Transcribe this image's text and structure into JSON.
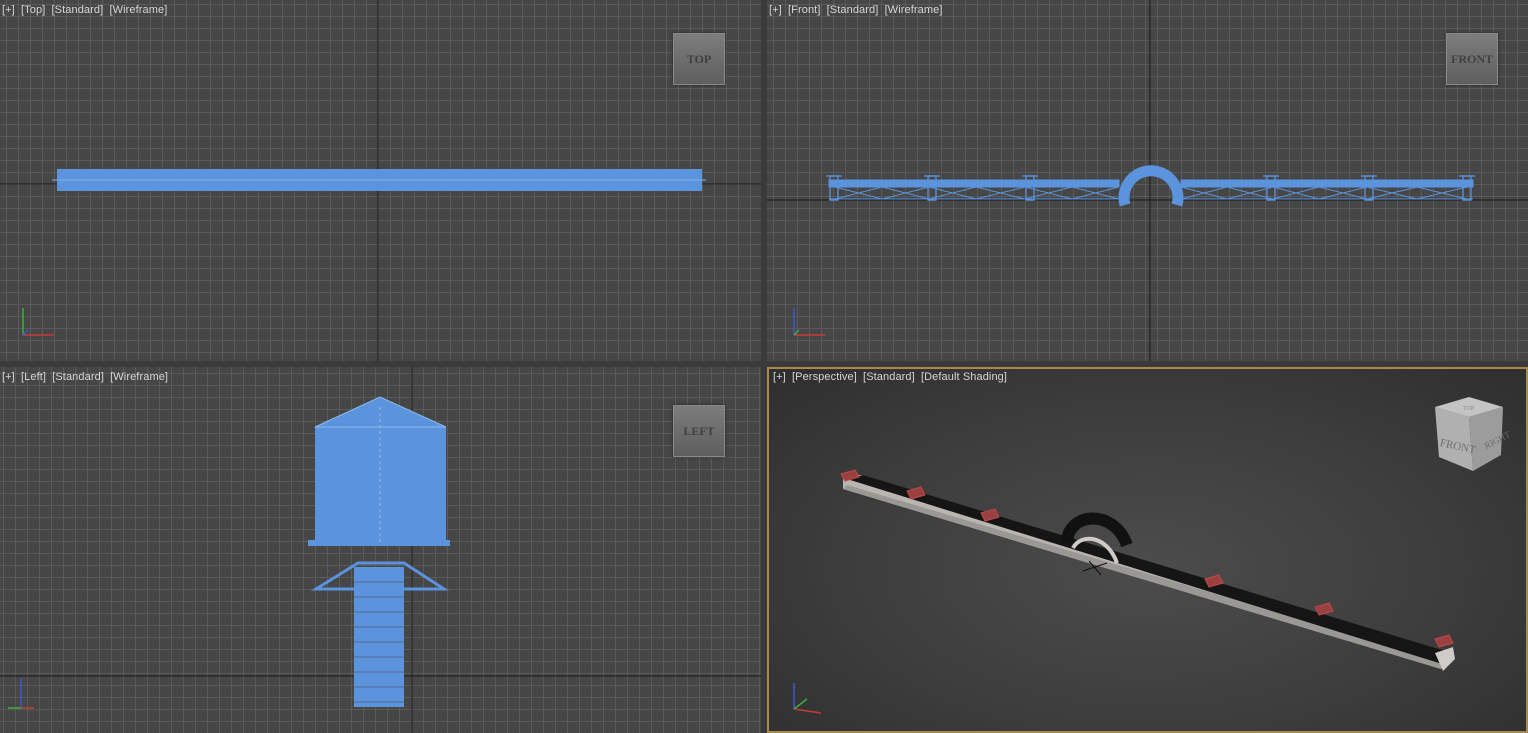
{
  "viewports": {
    "top": {
      "label": [
        "[+]",
        "[Top]",
        "[Standard]",
        "[Wireframe]"
      ],
      "cube": "TOP"
    },
    "front": {
      "label": [
        "[+]",
        "[Front]",
        "[Standard]",
        "[Wireframe]"
      ],
      "cube": "FRONT"
    },
    "left": {
      "label": [
        "[+]",
        "[Left]",
        "[Standard]",
        "[Wireframe]"
      ],
      "cube": "LEFT"
    },
    "perspective": {
      "label": [
        "[+]",
        "[Perspective]",
        "[Standard]",
        "[Default Shading]"
      ],
      "cube_front": "FRONT",
      "cube_right": "RIGHT",
      "cube_top": "TOP",
      "active": true
    }
  },
  "colors": {
    "wire": "#5b93dd",
    "grid": "#5a5a5a",
    "active_border": "#a68a52",
    "axis_x": "#c83a3a",
    "axis_y": "#3ab03a",
    "axis_z": "#3a5ad0"
  },
  "icons": [
    "axis-tripod-icon",
    "viewcube-icon"
  ]
}
